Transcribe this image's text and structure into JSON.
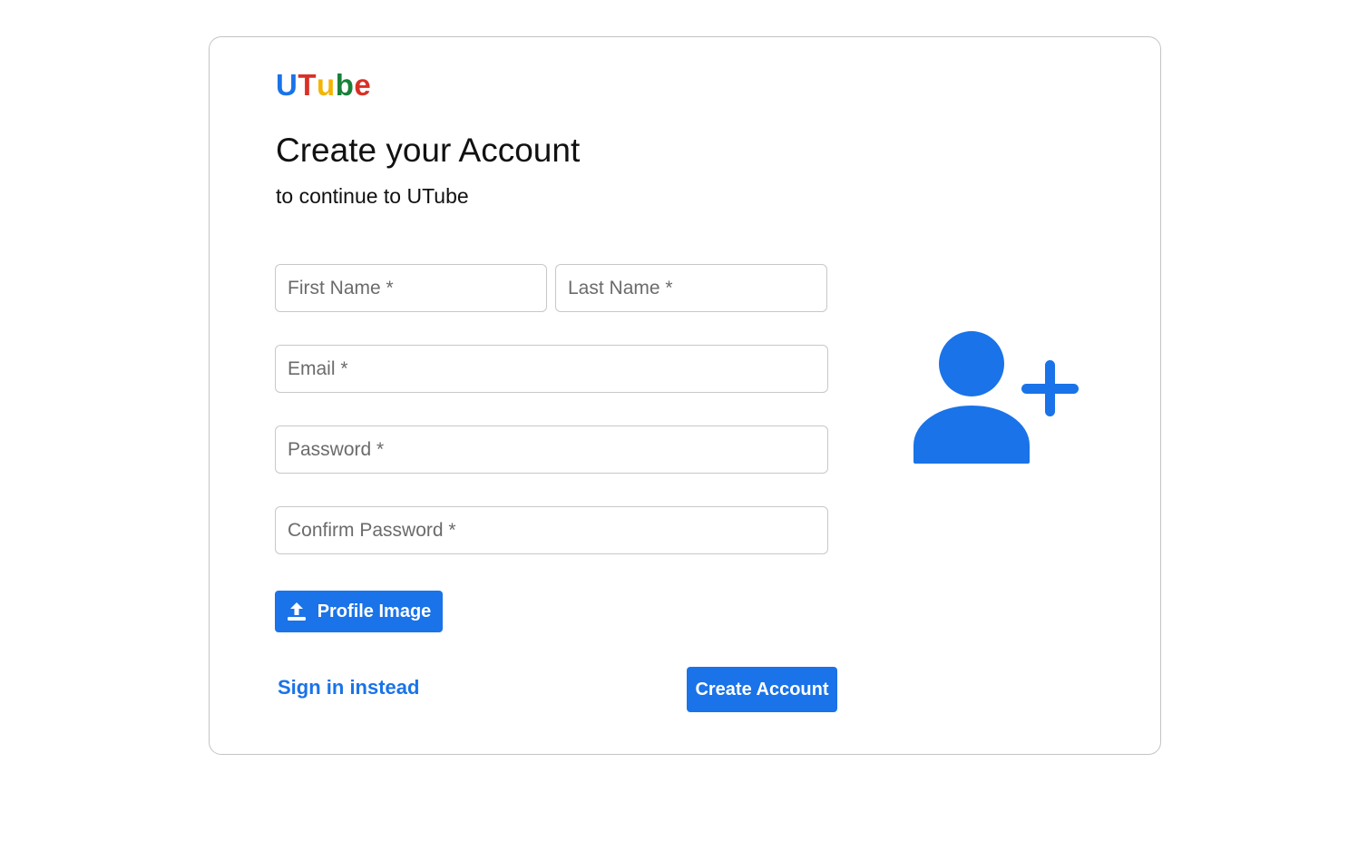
{
  "brand": {
    "letters": [
      {
        "char": "U",
        "color": "#1a73e8"
      },
      {
        "char": "T",
        "color": "#d93025"
      },
      {
        "char": "u",
        "color": "#f4b400"
      },
      {
        "char": "b",
        "color": "#188038"
      },
      {
        "char": "e",
        "color": "#d93025"
      }
    ]
  },
  "heading": {
    "title": "Create your Account",
    "subtitle": "to continue to UTube"
  },
  "form": {
    "first_name_placeholder": "First Name *",
    "last_name_placeholder": "Last Name *",
    "email_placeholder": "Email *",
    "password_placeholder": "Password *",
    "confirm_password_placeholder": "Confirm Password *",
    "profile_image_label": "Profile Image",
    "profile_image_icon": "upload-icon"
  },
  "actions": {
    "sign_in_label": "Sign in instead",
    "create_account_label": "Create Account"
  },
  "illustration": {
    "icon": "person-add-icon",
    "color": "#1a73e8"
  },
  "theme": {
    "accent": "#1a73e8",
    "border": "#c4c4c4"
  }
}
